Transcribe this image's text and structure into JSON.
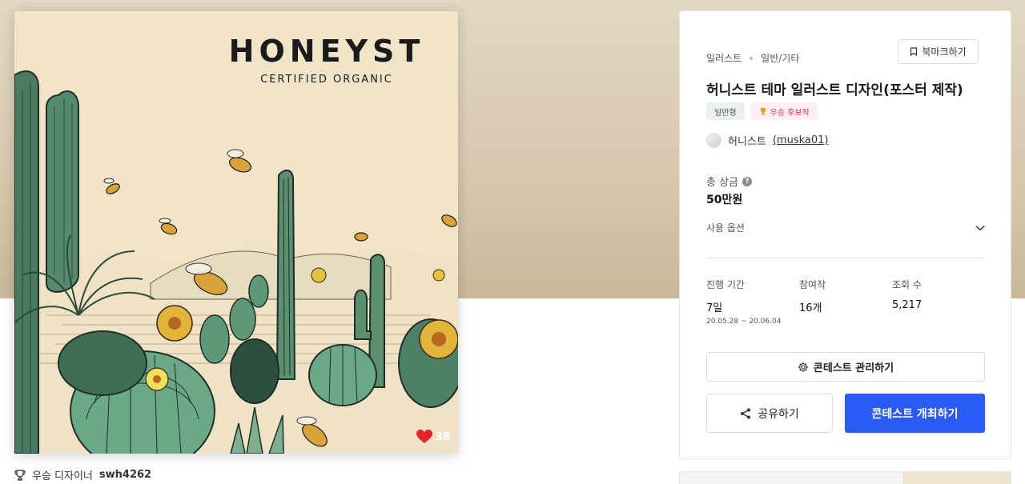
{
  "poster": {
    "brand": "HONEYST",
    "tagline": "CERTIFIED ORGANIC",
    "likes": "38"
  },
  "winner": {
    "label": "우승 디자이너",
    "name": "swh4262"
  },
  "contest": {
    "category": "일러스트",
    "subcategory": "일반/기타",
    "bookmark_label": "북마크하기",
    "title": "허니스트 테마 일러스트 디자인(포스터 제작)",
    "tags": [
      "일반형",
      "우승 후보작"
    ],
    "host_name": "허니스트",
    "host_handle": "(muska01)",
    "prize_label": "총 상금",
    "prize_value": "50만원",
    "usage_label": "사용 옵션",
    "stats": {
      "duration_label": "진행 기간",
      "duration_value": "7일",
      "duration_range": "20.05.28 ~ 20.06.04",
      "participants_label": "참여작",
      "participants_value": "16개",
      "views_label": "조회 수",
      "views_value": "5,217"
    },
    "manage_button": "콘테스트 관리하기",
    "share_button": "공유하기",
    "host_button": "콘테스트 개최하기"
  },
  "colors": {
    "primary": "#2a5cf5",
    "badge_pink": "#e0306a",
    "heart": "#e8232b"
  }
}
